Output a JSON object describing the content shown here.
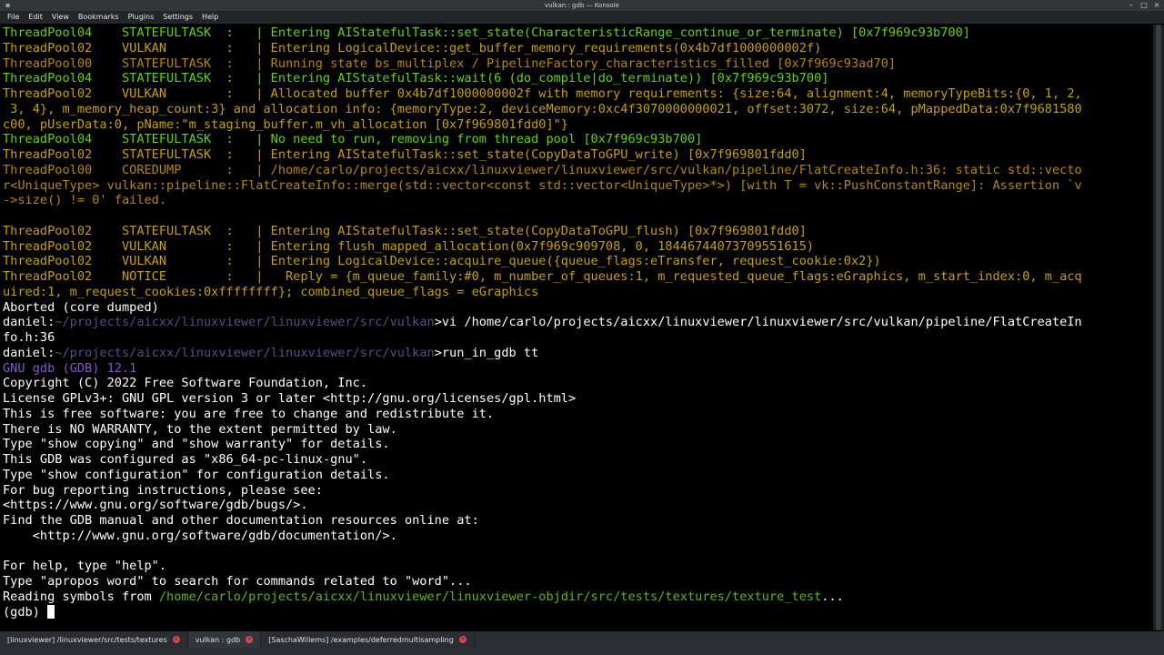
{
  "window": {
    "title": "vulkan : gdb — Konsole",
    "controls": [
      "–",
      "□",
      "×"
    ]
  },
  "menu": [
    "File",
    "Edit",
    "View",
    "Bookmarks",
    "Plugins",
    "Settings",
    "Help"
  ],
  "terminal": {
    "lines": [
      [
        {
          "t": "ThreadPool04    STATEFULTASK  :   | Entering AIStatefulTask::set_state(CharacteristicRange_continue_or_terminate) [0x7f969c93b700]",
          "c": "g"
        }
      ],
      [
        {
          "t": "ThreadPool02    VULKAN        :   | Entering LogicalDevice::get_buffer_memory_requirements(0x4b7df1000000002f)",
          "c": "y"
        }
      ],
      [
        {
          "t": "ThreadPool00    STATEFULTASK  :   | Running state bs_multiplex / PipelineFactory_characteristics_filled [0x7f969c93ad70]",
          "c": "o"
        }
      ],
      [
        {
          "t": "ThreadPool04    STATEFULTASK  :   | Entering AIStatefulTask::wait(6 (do_compile|do_terminate)) [0x7f969c93b700]",
          "c": "g"
        }
      ],
      [
        {
          "t": "ThreadPool02    VULKAN        :   | Allocated buffer 0x4b7df1000000002f with memory requirements: {size:64, alignment:4, memoryTypeBits:{0, 1, 2,",
          "c": "y"
        }
      ],
      [
        {
          "t": " 3, 4}, m_memory_heap_count:3} and allocation info: {memoryType:2, deviceMemory:0xc4f3070000000021, offset:3072, size:64, pMappedData:0x7f9681580",
          "c": "y"
        }
      ],
      [
        {
          "t": "c00, pUserData:0, pName:\"m_staging_buffer.m_vh_allocation [0x7f969801fdd0]\"}",
          "c": "y"
        }
      ],
      [
        {
          "t": "ThreadPool04    STATEFULTASK  :   | No need to run, removing from thread pool [0x7f969c93b700]",
          "c": "g"
        }
      ],
      [
        {
          "t": "ThreadPool02    STATEFULTASK  :   | Entering AIStatefulTask::set_state(CopyDataToGPU_write) [0x7f969801fdd0]",
          "c": "y"
        }
      ],
      [
        {
          "t": "ThreadPool00    COREDUMP      :   | /home/carlo/projects/aicxx/linuxviewer/linuxviewer/src/vulkan/pipeline/FlatCreateInfo.h:36: static std::vecto",
          "c": "o"
        }
      ],
      [
        {
          "t": "r<UniqueType> vulkan::pipeline::FlatCreateInfo::merge(std::vector<const std::vector<UniqueType>*>) [with T = vk::PushConstantRange]: Assertion `v",
          "c": "o"
        }
      ],
      [
        {
          "t": "->size() != 0' failed.",
          "c": "o"
        }
      ],
      [
        {
          "t": "",
          "c": "w"
        }
      ],
      [
        {
          "t": "ThreadPool02    STATEFULTASK  :   | Entering AIStatefulTask::set_state(CopyDataToGPU_flush) [0x7f969801fdd0]",
          "c": "y"
        }
      ],
      [
        {
          "t": "ThreadPool02    VULKAN        :   | Entering flush_mapped_allocation(0x7f969c909708, 0, 18446744073709551615)",
          "c": "y"
        }
      ],
      [
        {
          "t": "ThreadPool02    VULKAN        :   | Entering LogicalDevice::acquire_queue({queue_flags:eTransfer, request_cookie:0x2})",
          "c": "y"
        }
      ],
      [
        {
          "t": "ThreadPool02    NOTICE        :   |   Reply = {m_queue_family:#0, m_number_of_queues:1, m_requested_queue_flags:eGraphics, m_start_index:0, m_acq",
          "c": "y"
        }
      ],
      [
        {
          "t": "uired:1, m_request_cookies:0xffffffff}; combined_queue_flags = eGraphics",
          "c": "y"
        }
      ],
      [
        {
          "t": "Aborted (core dumped)",
          "c": "w"
        }
      ],
      [
        {
          "t": "daniel:",
          "c": "w"
        },
        {
          "t": "~/projects/aicxx/linuxviewer/linuxviewer/src/vulkan",
          "c": "path"
        },
        {
          "t": ">vi /home/carlo/projects/aicxx/linuxviewer/linuxviewer/src/vulkan/pipeline/FlatCreateIn",
          "c": "w"
        }
      ],
      [
        {
          "t": "fo.h:36",
          "c": "w"
        }
      ],
      [
        {
          "t": "daniel:",
          "c": "w"
        },
        {
          "t": "~/projects/aicxx/linuxviewer/linuxviewer/src/vulkan",
          "c": "path"
        },
        {
          "t": ">run_in_gdb tt",
          "c": "w"
        }
      ],
      [
        {
          "t": "GNU gdb (GDB) 12.1",
          "c": "p"
        }
      ],
      [
        {
          "t": "Copyright (C) 2022 Free Software Foundation, Inc.",
          "c": "w"
        }
      ],
      [
        {
          "t": "License GPLv3+: GNU GPL version 3 or later <http://gnu.org/licenses/gpl.html>",
          "c": "w"
        }
      ],
      [
        {
          "t": "This is free software: you are free to change and redistribute it.",
          "c": "w"
        }
      ],
      [
        {
          "t": "There is NO WARRANTY, to the extent permitted by law.",
          "c": "w"
        }
      ],
      [
        {
          "t": "Type \"show copying\" and \"show warranty\" for details.",
          "c": "w"
        }
      ],
      [
        {
          "t": "This GDB was configured as \"x86_64-pc-linux-gnu\".",
          "c": "w"
        }
      ],
      [
        {
          "t": "Type \"show configuration\" for configuration details.",
          "c": "w"
        }
      ],
      [
        {
          "t": "For bug reporting instructions, please see:",
          "c": "w"
        }
      ],
      [
        {
          "t": "<https://www.gnu.org/software/gdb/bugs/>.",
          "c": "w"
        }
      ],
      [
        {
          "t": "Find the GDB manual and other documentation resources online at:",
          "c": "w"
        }
      ],
      [
        {
          "t": "    <http://www.gnu.org/software/gdb/documentation/>.",
          "c": "w"
        }
      ],
      [
        {
          "t": "",
          "c": "w"
        }
      ],
      [
        {
          "t": "For help, type \"help\".",
          "c": "w"
        }
      ],
      [
        {
          "t": "Type \"apropos word\" to search for commands related to \"word\"...",
          "c": "w"
        }
      ],
      [
        {
          "t": "Reading symbols from ",
          "c": "w"
        },
        {
          "t": "/home/carlo/projects/aicxx/linuxviewer/linuxviewer-objdir/src/tests/textures/texture_test",
          "c": "gpath"
        },
        {
          "t": "...",
          "c": "w"
        }
      ],
      [
        {
          "t": "(gdb) ",
          "c": "w"
        }
      ]
    ]
  },
  "tabs": [
    {
      "label": "[linuxviewer] /linuxviewer/src/tests/textures",
      "active": false
    },
    {
      "label": "vulkan : gdb",
      "active": true
    },
    {
      "label": "[SaschaWillems] /examples/deferredmultisampling",
      "active": false
    }
  ],
  "colors": {
    "green": "#5fd700",
    "yellow": "#c8a000",
    "orange": "#b58900",
    "purple": "#8a55c8",
    "path": "#5c4a8a",
    "close": "#da4453"
  }
}
